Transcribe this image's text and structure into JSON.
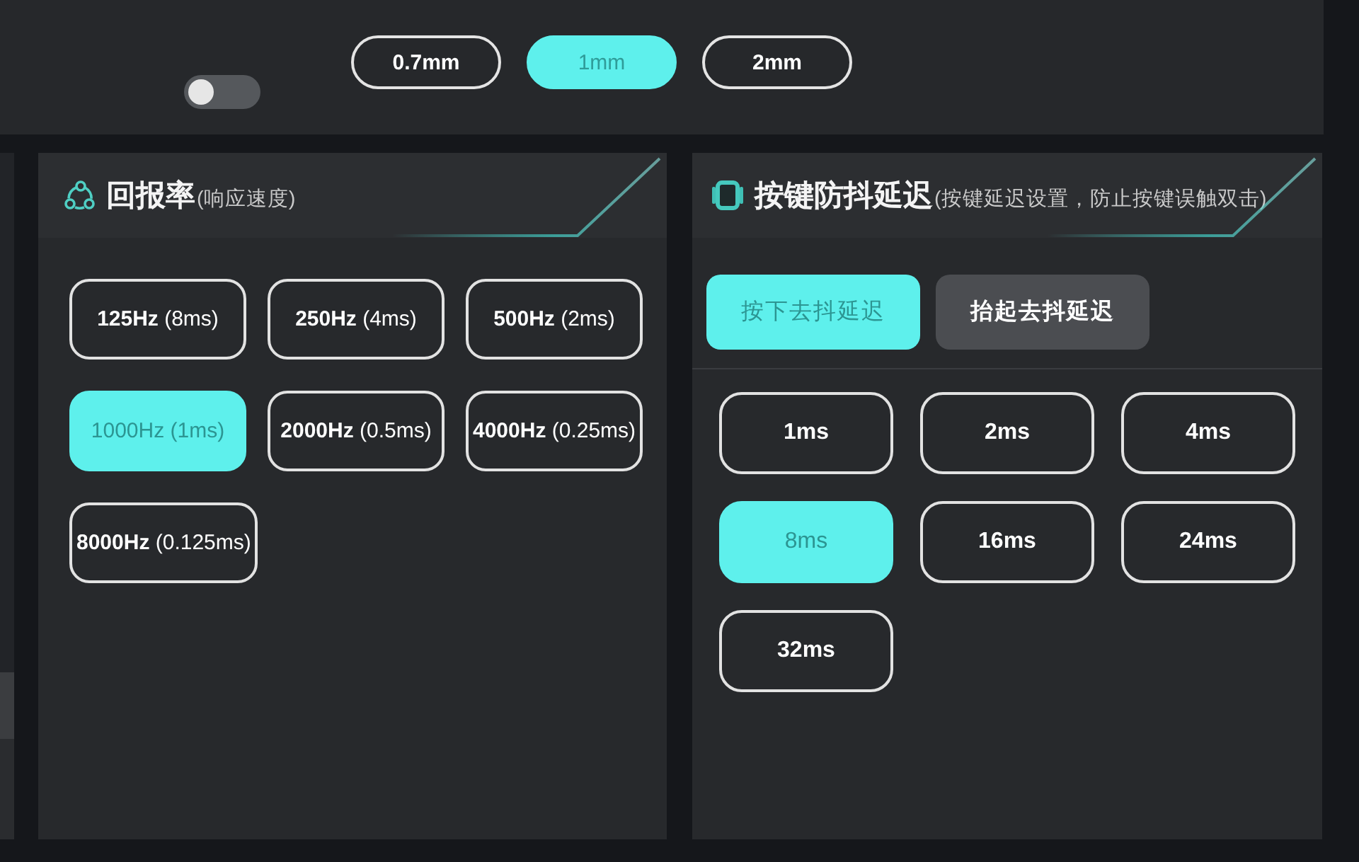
{
  "top_bar": {
    "toggle": {
      "on": false
    },
    "distance_options": [
      {
        "label": "0.7mm",
        "selected": false
      },
      {
        "label": "1mm",
        "selected": true
      },
      {
        "label": "2mm",
        "selected": false
      }
    ]
  },
  "report_rate_panel": {
    "title": "回报率",
    "subtitle": "(响应速度)",
    "options": [
      {
        "rate": "125Hz",
        "interval": "(8ms)",
        "selected": false
      },
      {
        "rate": "250Hz",
        "interval": "(4ms)",
        "selected": false
      },
      {
        "rate": "500Hz",
        "interval": "(2ms)",
        "selected": false
      },
      {
        "rate": "1000Hz",
        "interval": "(1ms)",
        "selected": true
      },
      {
        "rate": "2000Hz",
        "interval": "(0.5ms)",
        "selected": false
      },
      {
        "rate": "4000Hz",
        "interval": "(0.25ms)",
        "selected": false
      },
      {
        "rate": "8000Hz",
        "interval": "(0.125ms)",
        "selected": false
      }
    ]
  },
  "debounce_panel": {
    "title": "按键防抖延迟",
    "subtitle": "(按键延迟设置，防止按键误触双击)",
    "tabs": [
      {
        "label": "按下去抖延迟",
        "selected": true
      },
      {
        "label": "抬起去抖延迟",
        "selected": false
      }
    ],
    "options": [
      {
        "label": "1ms",
        "selected": false
      },
      {
        "label": "2ms",
        "selected": false
      },
      {
        "label": "4ms",
        "selected": false
      },
      {
        "label": "8ms",
        "selected": true
      },
      {
        "label": "16ms",
        "selected": false
      },
      {
        "label": "24ms",
        "selected": false
      },
      {
        "label": "32ms",
        "selected": false
      }
    ]
  }
}
